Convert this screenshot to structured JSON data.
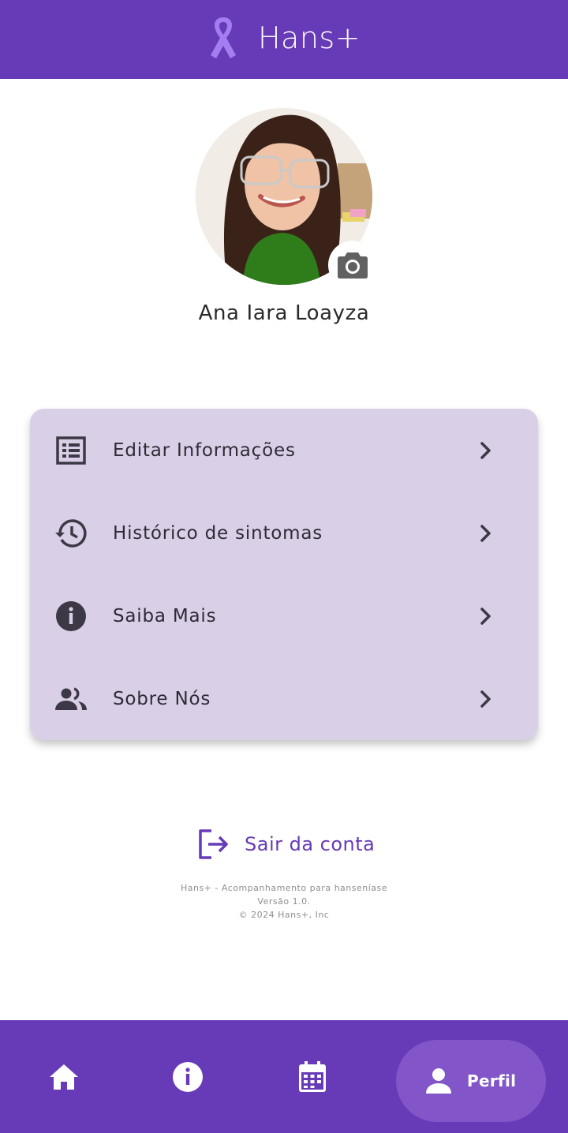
{
  "header": {
    "app_title": "Hans+",
    "logo_icon": "awareness-ribbon-icon"
  },
  "profile": {
    "name": "Ana Iara Loayza",
    "avatar_icon": "profile-photo",
    "camera_icon": "camera-icon"
  },
  "menu": {
    "items": [
      {
        "label": "Editar Informações",
        "icon": "list-form-icon"
      },
      {
        "label": "Histórico de sintomas",
        "icon": "history-icon"
      },
      {
        "label": "Saiba Mais",
        "icon": "info-icon"
      },
      {
        "label": "Sobre Nós",
        "icon": "people-icon"
      }
    ]
  },
  "logout": {
    "label": "Sair da conta",
    "icon": "logout-icon"
  },
  "footer": {
    "line1": "Hans+ -  Acompanhamento para hanseníase",
    "line2": "Versão 1.0.",
    "line3": "© 2024 Hans+, Inc"
  },
  "bottom_nav": {
    "items": [
      {
        "icon": "home-icon"
      },
      {
        "icon": "info-icon"
      },
      {
        "icon": "calendar-icon"
      }
    ],
    "active": {
      "label": "Perfil",
      "icon": "person-icon"
    }
  },
  "colors": {
    "primary": "#673ab7",
    "menu_card_bg": "#d9d0e7",
    "active_pill": "#8256c8",
    "ribbon": "#a47ef0"
  }
}
